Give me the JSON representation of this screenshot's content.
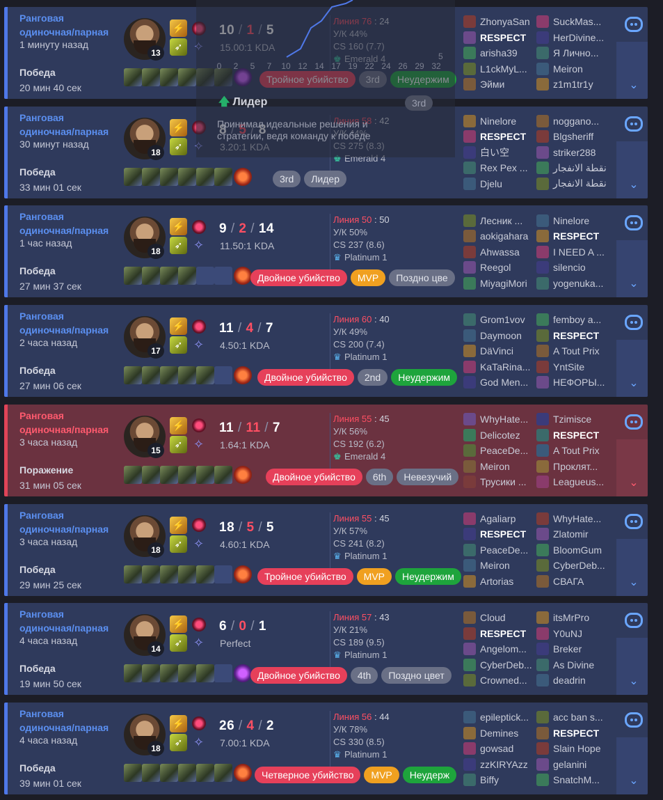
{
  "matches": [
    {
      "queue": "Ранговая одиночная/парная",
      "ago": "1 минуту назад",
      "result": "Победа",
      "duration": "20 мин 40 сек",
      "level": "13",
      "k": "10",
      "d": "1",
      "a": "5",
      "kda": "15.00:1 KDA",
      "pk_label": "Линия 76",
      "pk_value": "24",
      "kp": "У/К 44%",
      "cs": "CS 160 (7.7)",
      "rank": "Emerald 4",
      "badges": [
        {
          "text": "Тройное убийство",
          "c": "red"
        },
        {
          "text": "3rd",
          "c": "gray"
        },
        {
          "text": "Неудержим",
          "c": "green"
        }
      ],
      "team1": [
        "ZhonyaSan",
        "RESPECT",
        "arisha39",
        "L1ckMyL...",
        "Эйми"
      ],
      "team2": [
        "SuckMas...",
        "HerDivine...",
        "Я Лично...",
        "Meiron",
        "z1m1tr1y"
      ],
      "loss": false
    },
    {
      "queue": "Ранговая одиночная/парная",
      "ago": "30 минут назад",
      "result": "Победа",
      "duration": "33 мин 01 сек",
      "level": "18",
      "k": "8",
      "d": "5",
      "a": "8",
      "kda": "3.20:1 KDA",
      "pk_label": "Линия 58",
      "pk_value": "42",
      "kp": "У/К 44%",
      "cs": "CS 275 (8.3)",
      "rank": "Emerald 4",
      "badges": [
        {
          "text": "3rd",
          "c": "gray"
        },
        {
          "text": "Лидер",
          "c": "gray"
        }
      ],
      "team1": [
        "Ninelore",
        "RESPECT",
        "白い空",
        "Rex Pex ...",
        "Djelu"
      ],
      "team2": [
        "noggano...",
        "Blgsheriff",
        "striker288",
        "نقطة الانفجار",
        "نقطة الانفجار"
      ],
      "loss": false
    },
    {
      "queue": "Ранговая одиночная/парная",
      "ago": "1 час назад",
      "result": "Победа",
      "duration": "27 мин 37 сек",
      "level": "18",
      "k": "9",
      "d": "2",
      "a": "14",
      "kda": "11.50:1 KDA",
      "pk_label": "Линия 50",
      "pk_value": "50",
      "kp": "У/К 50%",
      "cs": "CS 237 (8.6)",
      "rank": "Platinum 1",
      "badges": [
        {
          "text": "Двойное убийство",
          "c": "red"
        },
        {
          "text": "MVP",
          "c": "orange"
        },
        {
          "text": "Поздно цве",
          "c": "gray"
        }
      ],
      "team1": [
        "Лесник ...",
        "aokigahara",
        "Ahwassa",
        "Reegol",
        "MiyagiMori"
      ],
      "team2": [
        "Ninelore",
        "RESPECT",
        "I NEED A ...",
        "silencio",
        "yogenuka..."
      ],
      "loss": false
    },
    {
      "queue": "Ранговая одиночная/парная",
      "ago": "2 часа назад",
      "result": "Победа",
      "duration": "27 мин 06 сек",
      "level": "17",
      "k": "11",
      "d": "4",
      "a": "7",
      "kda": "4.50:1 KDA",
      "pk_label": "Линия 60",
      "pk_value": "40",
      "kp": "У/К 49%",
      "cs": "CS 200 (7.4)",
      "rank": "Platinum 1",
      "badges": [
        {
          "text": "Двойное убийство",
          "c": "red"
        },
        {
          "text": "2nd",
          "c": "gray"
        },
        {
          "text": "Неудержим",
          "c": "green"
        }
      ],
      "team1": [
        "Grom1vov",
        "Daymoon",
        "DäVinci",
        "KaTaRina...",
        "God Men..."
      ],
      "team2": [
        "femboy a...",
        "RESPECT",
        "A Tout Prix",
        "YntSite",
        "НЕФОРЫ..."
      ],
      "loss": false
    },
    {
      "queue": "Ранговая одиночная/парная",
      "ago": "3 часа назад",
      "result": "Поражение",
      "duration": "31 мин 05 сек",
      "level": "15",
      "k": "11",
      "d": "11",
      "a": "7",
      "kda": "1.64:1 KDA",
      "pk_label": "Линия 55",
      "pk_value": "45",
      "kp": "У/К 56%",
      "cs": "CS 192 (6.2)",
      "rank": "Emerald 4",
      "badges": [
        {
          "text": "Двойное убийство",
          "c": "red"
        },
        {
          "text": "6th",
          "c": "gray"
        },
        {
          "text": "Невезучий",
          "c": "gray"
        }
      ],
      "team1": [
        "WhyHate...",
        "Delicotez",
        "PeaceDe...",
        "Meiron",
        "Трусики ..."
      ],
      "team2": [
        "Tzimisce",
        "RESPECT",
        "A Tout Prix",
        "Проклят...",
        "Leagueus..."
      ],
      "loss": true
    },
    {
      "queue": "Ранговая одиночная/парная",
      "ago": "3 часа назад",
      "result": "Победа",
      "duration": "29 мин 25 сек",
      "level": "18",
      "k": "18",
      "d": "5",
      "a": "5",
      "kda": "4.60:1 KDA",
      "pk_label": "Линия 55",
      "pk_value": "45",
      "kp": "У/К 57%",
      "cs": "CS 241 (8.2)",
      "rank": "Platinum 1",
      "badges": [
        {
          "text": "Тройное убийство",
          "c": "red"
        },
        {
          "text": "MVP",
          "c": "orange"
        },
        {
          "text": "Неудержим",
          "c": "green"
        }
      ],
      "team1": [
        "Agaliarp",
        "RESPECT",
        "PeaceDe...",
        "Meiron",
        "Artorias"
      ],
      "team2": [
        "WhyHate...",
        "Zlatomir",
        "BloomGum",
        "CyberDeb...",
        "СВАГА"
      ],
      "loss": false
    },
    {
      "queue": "Ранговая одиночная/парная",
      "ago": "4 часа назад",
      "result": "Победа",
      "duration": "19 мин 50 сек",
      "level": "14",
      "k": "6",
      "d": "0",
      "a": "1",
      "kda": "Perfect",
      "pk_label": "Линия 57",
      "pk_value": "43",
      "kp": "У/К 21%",
      "cs": "CS 189 (9.5)",
      "rank": "Platinum 1",
      "badges": [
        {
          "text": "Двойное убийство",
          "c": "red"
        },
        {
          "text": "4th",
          "c": "gray"
        },
        {
          "text": "Поздно цвет",
          "c": "gray"
        }
      ],
      "team1": [
        "Cloud",
        "RESPECT",
        "Angelom...",
        "CyberDeb...",
        "Crowned..."
      ],
      "team2": [
        "itsMrPro",
        "Y0uNJ",
        "Breker",
        "As Divine",
        "deadrin"
      ],
      "loss": false
    },
    {
      "queue": "Ранговая одиночная/парная",
      "ago": "4 часа назад",
      "result": "Победа",
      "duration": "39 мин 01 сек",
      "level": "18",
      "k": "26",
      "d": "4",
      "a": "2",
      "kda": "7.00:1 KDA",
      "pk_label": "Линия 56",
      "pk_value": "44",
      "kp": "У/К 78%",
      "cs": "CS 330 (8.5)",
      "rank": "Platinum 1",
      "badges": [
        {
          "text": "Четверное убийство",
          "c": "red"
        },
        {
          "text": "MVP",
          "c": "orange"
        },
        {
          "text": "Неудерж",
          "c": "green"
        }
      ],
      "team1": [
        "epileptick...",
        "Demines",
        "gowsad",
        "zzKIRYAzz",
        "Biffy"
      ],
      "team2": [
        "acc ban s...",
        "RESPECT",
        "Slain Hope",
        "gelanini",
        "SnatchM..."
      ],
      "loss": false
    }
  ],
  "tooltip": {
    "title": "Лидер",
    "rank": "3rd",
    "description": "Принимал идеальные решения и стратегии, ведя команду к победе",
    "axis": [
      "0",
      "2",
      "5",
      "7",
      "10",
      "12",
      "14",
      "17",
      "19",
      "22",
      "24",
      "26",
      "29",
      "32"
    ],
    "y_tick": "5"
  },
  "me_name": "RESPECT"
}
